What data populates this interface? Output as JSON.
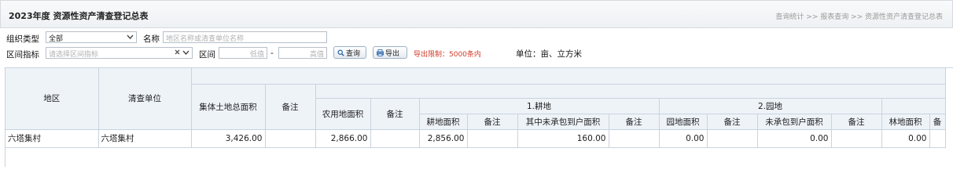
{
  "header": {
    "title": "2023年度 资源性资产清查登记总表",
    "breadcrumb": "查询统计 >> 报表查询 >> 资源性资产清查登记总表"
  },
  "filters": {
    "org_type_label": "组织类型",
    "org_type_value": "全部",
    "name_label": "名称",
    "name_placeholder": "地区名称或清查单位名称",
    "range_indicator_label": "区间指标",
    "range_indicator_placeholder": "请选择区间指标",
    "range_label": "区间",
    "low_placeholder": "低值",
    "range_sep": "-",
    "high_placeholder": "高值",
    "query_button": "查询",
    "export_button": "导出",
    "export_limit": "导出限制：5000条内",
    "unit_text": "单位：亩、立方米"
  },
  "icons": {
    "select_chevron": "chevron-down-icon",
    "clear": "clear-icon",
    "search": "search-icon",
    "export": "printer-icon"
  },
  "table": {
    "headers": {
      "region": "地区",
      "unit": "清查单位",
      "collective_total": "集体土地总面积",
      "remark": "备注",
      "farm_area": "农用地面积",
      "group1": "1.耕地",
      "group2": "2.园地",
      "arable_area": "耕地面积",
      "uncontracted_within": "其中未承包到户面积",
      "orchard_area": "园地面积",
      "uncontracted": "未承包到户面积",
      "forest_area": "林地面积",
      "trailing": "备"
    },
    "rows": [
      {
        "region": "六塔集村",
        "unit": "六塔集村",
        "collective_total": "3,426.00",
        "collective_remark": "",
        "farm_area": "2,866.00",
        "farm_remark": "",
        "arable_area": "2,856.00",
        "arable_remark": "",
        "uncontracted_arable": "160.00",
        "uncontracted_arable_remark": "",
        "orchard_area": "0.00",
        "orchard_remark": "",
        "uncontracted_orchard": "0.00",
        "uncontracted_orchard_remark": "",
        "forest_area": "0.00"
      }
    ]
  },
  "colors": {
    "header_bg": "#eef3f8",
    "grid_line": "#c9d3de",
    "limit_text": "#d23b2a"
  }
}
